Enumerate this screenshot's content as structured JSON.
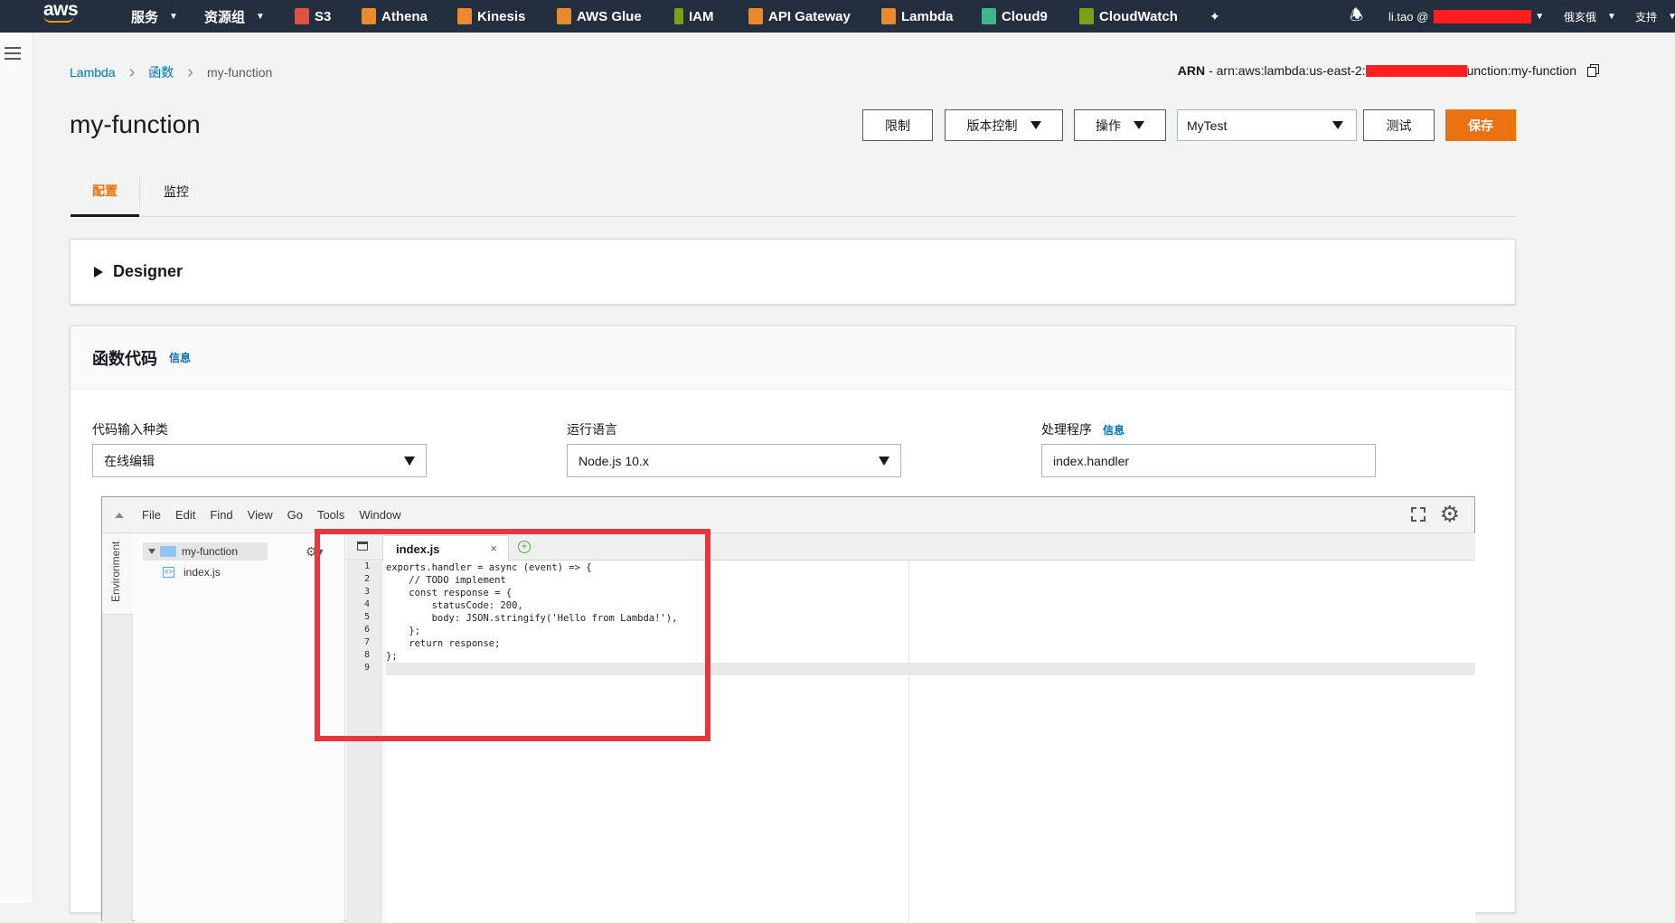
{
  "topnav": {
    "logo_text": "aws",
    "services_label": "服务",
    "resource_groups_label": "资源组",
    "shortcuts": [
      {
        "label": "S3",
        "icon": "s3-icon",
        "color": "#e05243"
      },
      {
        "label": "Athena",
        "icon": "athena-icon",
        "color": "#e88a2d"
      },
      {
        "label": "Kinesis",
        "icon": "kinesis-icon",
        "color": "#e88a2d"
      },
      {
        "label": "AWS Glue",
        "icon": "glue-icon",
        "color": "#e88a2d"
      },
      {
        "label": "IAM",
        "icon": "iam-icon",
        "color": "#7aa116"
      },
      {
        "label": "API Gateway",
        "icon": "api-gateway-icon",
        "color": "#e88a2d"
      },
      {
        "label": "Lambda",
        "icon": "lambda-icon",
        "color": "#e88a2d"
      },
      {
        "label": "Cloud9",
        "icon": "cloud9-icon",
        "color": "#3fb68b"
      },
      {
        "label": "CloudWatch",
        "icon": "cloudwatch-icon",
        "color": "#7aa116"
      }
    ],
    "user_label": "li.tao @",
    "region_label": "俄亥俄",
    "support_label": "支持"
  },
  "breadcrumb": {
    "items": [
      "Lambda",
      "函数"
    ],
    "current": "my-function"
  },
  "arn": {
    "label": "ARN",
    "prefix": "- arn:aws:lambda:us-east-2:",
    "suffix": "unction:my-function"
  },
  "page_title": "my-function",
  "actions": {
    "throttle": "限制",
    "versions": "版本控制",
    "operations": "操作",
    "test_event": "MyTest",
    "test": "测试",
    "save": "保存"
  },
  "tabs": [
    "配置",
    "监控"
  ],
  "designer": {
    "label": "Designer"
  },
  "function_code": {
    "title": "函数代码",
    "info": "信息",
    "fields": {
      "code_entry_label": "代码输入种类",
      "code_entry_value": "在线编辑",
      "runtime_label": "运行语言",
      "runtime_value": "Node.js 10.x",
      "handler_label": "处理程序",
      "handler_info": "信息",
      "handler_value": "index.handler"
    }
  },
  "ide": {
    "menu": [
      "File",
      "Edit",
      "Find",
      "View",
      "Go",
      "Tools",
      "Window"
    ],
    "environment_tab": "Environment",
    "tree": {
      "root": "my-function",
      "files": [
        "index.js"
      ]
    },
    "open_tab": "index.js",
    "line_numbers": [
      "1",
      "2",
      "3",
      "4",
      "5",
      "6",
      "7",
      "8",
      "9"
    ],
    "code_lines": [
      "exports.handler = async (event) => {",
      "    // TODO implement",
      "    const response = {",
      "        statusCode: 200,",
      "        body: JSON.stringify('Hello from Lambda!'),",
      "    };",
      "    return response;",
      "};",
      ""
    ]
  },
  "colors": {
    "nav_bg": "#232f3e",
    "primary": "#ec7211",
    "link": "#0073bb",
    "highlight": "#e63740"
  }
}
